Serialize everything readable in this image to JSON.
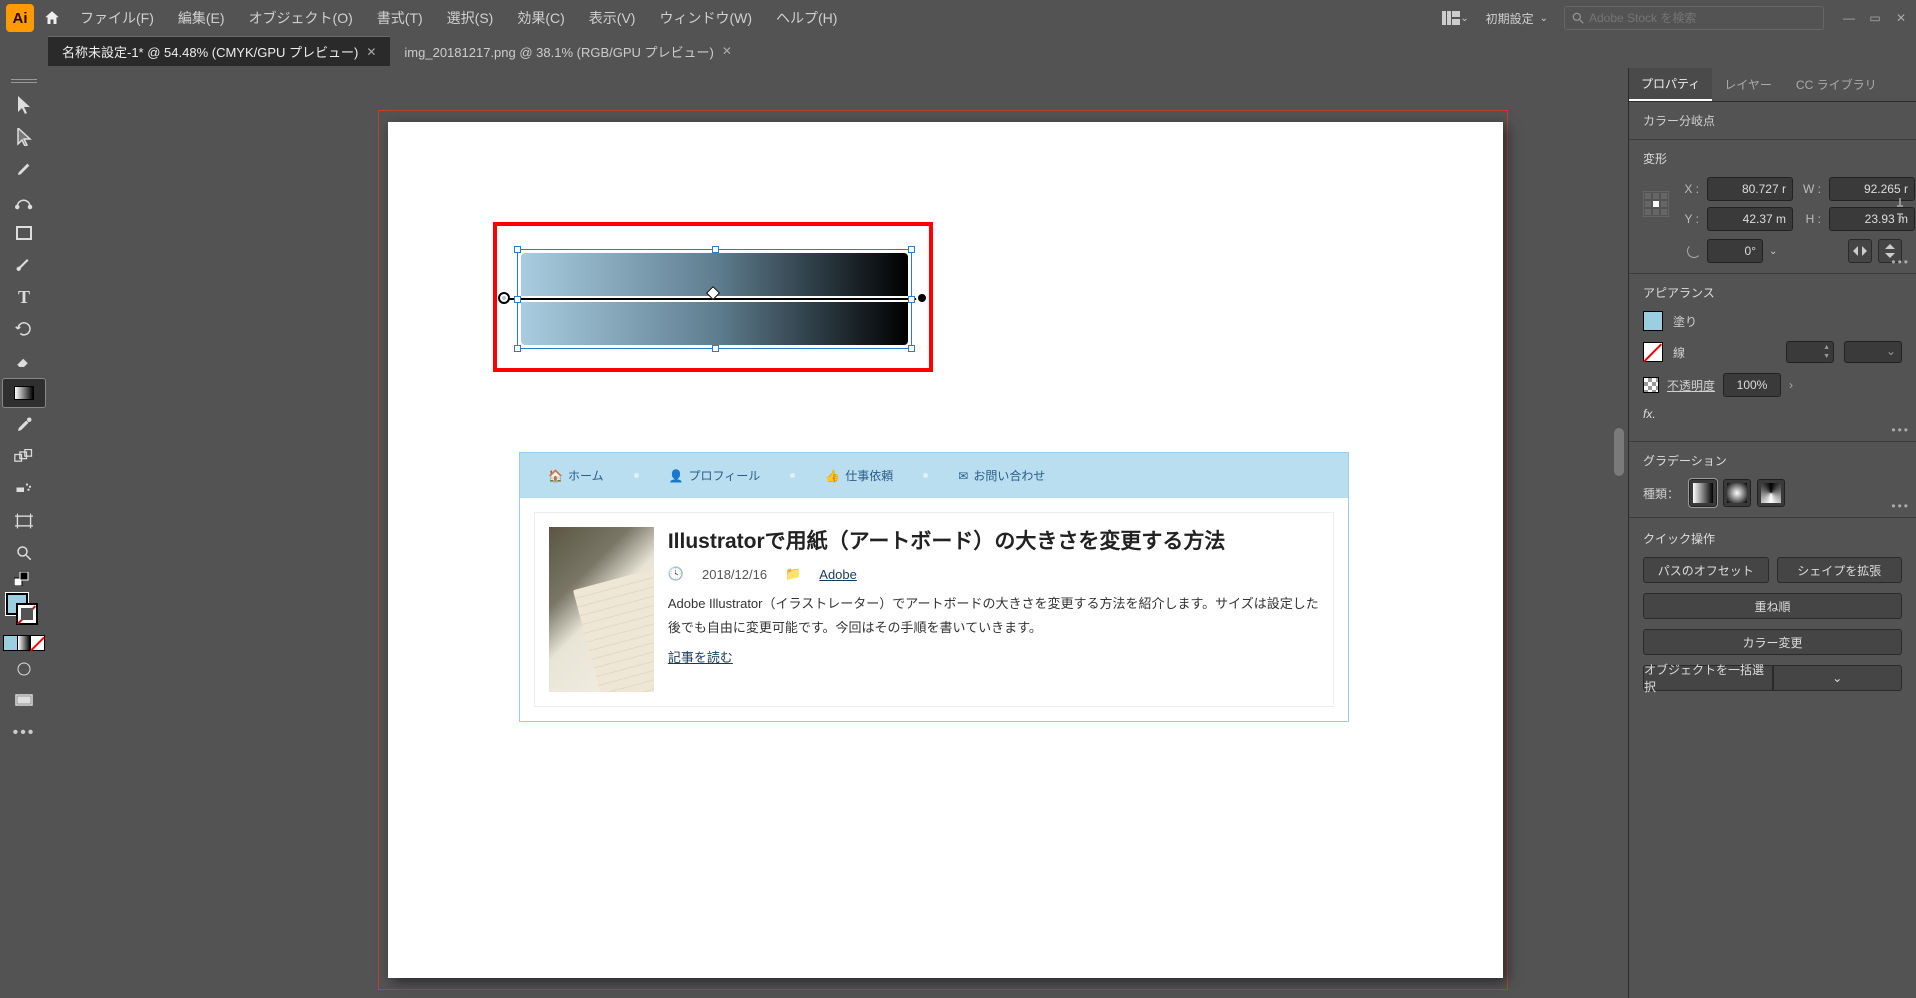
{
  "app": {
    "name": "Ai"
  },
  "menu": {
    "file": "ファイル(F)",
    "edit": "編集(E)",
    "object": "オブジェクト(O)",
    "type": "書式(T)",
    "select": "選択(S)",
    "effect": "効果(C)",
    "view": "表示(V)",
    "window": "ウィンドウ(W)",
    "help": "ヘルプ(H)"
  },
  "workspace": "初期設定",
  "search": {
    "placeholder": "Adobe Stock を検索"
  },
  "tabs": [
    {
      "label": "名称未設定-1* @ 54.48% (CMYK/GPU プレビュー)",
      "active": true
    },
    {
      "label": "img_20181217.png @ 38.1% (RGB/GPU プレビュー)",
      "active": false
    }
  ],
  "article": {
    "nav": {
      "home": "ホーム",
      "profile": "プロフィール",
      "work": "仕事依頼",
      "contact": "お問い合わせ"
    },
    "title": "Illustratorで用紙（アートボード）の大きさを変更する方法",
    "date": "2018/12/16",
    "cat": "Adobe",
    "excerpt": "Adobe Illustrator（イラストレーター）でアートボードの大きさを変更する方法を紹介します。サイズは設定した後でも自由に変更可能です。今回はその手順を書いていきます。",
    "readmore": "記事を読む"
  },
  "panels": {
    "tabs": {
      "prop": "プロパティ",
      "layer": "レイヤー",
      "cc": "CC ライブラリ"
    },
    "target": "カラー分岐点",
    "transform": {
      "title": "変形",
      "x": "80.727 r",
      "y": "42.37 m",
      "w": "92.265 r",
      "h": "23.93 m",
      "xl": "X :",
      "yl": "Y :",
      "wl": "W :",
      "hl": "H :",
      "angle": "0°"
    },
    "appearance": {
      "title": "アピアランス",
      "fill": "塗り",
      "stroke": "線",
      "opacity": "不透明度",
      "opv": "100%",
      "fx": "fx."
    },
    "gradient": {
      "title": "グラデーション",
      "typelabel": "種類："
    },
    "quick": {
      "title": "クイック操作",
      "offset": "パスのオフセット",
      "expand": "シェイプを拡張",
      "arrange": "重ね順",
      "recolor": "カラー変更",
      "select_similar": "オブジェクトを一括選択"
    }
  },
  "tools": {
    "selection": "selection-tool",
    "direct": "direct-selection-tool",
    "pen": "pen-tool",
    "curvature": "curvature-tool",
    "rect": "rectangle-tool",
    "brush": "paintbrush-tool",
    "text": "type-tool",
    "rotate": "rotate-tool",
    "eraser": "eraser-tool",
    "gradient": "gradient-tool",
    "eyedrop": "eyedropper-tool",
    "blend": "blend-tool",
    "symbol": "symbol-sprayer-tool",
    "artboard": "artboard-tool",
    "zoom": "zoom-tool"
  }
}
